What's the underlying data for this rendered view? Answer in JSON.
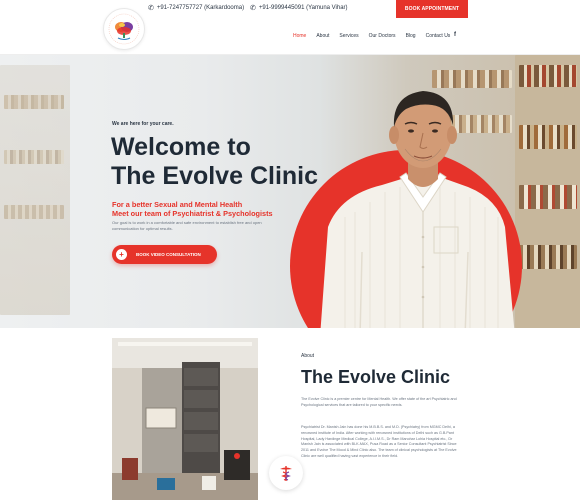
{
  "topbar": {
    "phone1": "+91-7247757727 (Karkardooma)",
    "phone2": "+91-9999445091 (Yamuna Vihar)",
    "book_label": "BOOK APPOINTMENT"
  },
  "nav": {
    "items": [
      "Home",
      "About",
      "Services",
      "Our Doctors",
      "Blog",
      "Contact Us"
    ],
    "active": "Home",
    "social": "f"
  },
  "hero": {
    "tagline": "We are here for your care.",
    "title_line1": "Welcome to",
    "title_line2": "The Evolve Clinic",
    "sub_line1": "For a better Sexual and Mental Health",
    "sub_line2": "Meet our team of Psychiatrist & Psychologists",
    "description": "Our goal is to work in a comfortable and safe environment to establish free and open communication for optimal results.",
    "cta_label": "BOOK VIDEO CONSULTATION",
    "cta_icon": "+"
  },
  "about": {
    "label": "About",
    "title": "The Evolve Clinic",
    "para1": "The Evolve Clinic is a premier centre for Mental Health. We offer state of the art Psychiatric and Psychological services that are tailored to your specific needs.",
    "para2": "Psychiatrist Dr. Manish Jain has done his M.B.B.S. and M.D. (Psychiatry) from MGMC Delhi, a renowned institute of India. After working with renowned institutions of Delhi such as G.B.Pant Hospital, Lady Hardinge Medical College, A.I.I.M.S., Dr Ram Manohar Lohia Hospital etc., Dr Manish Jain is associated with BLK-MAX, Pusa Road as a Senior Consultant Psychiatrist Since 2011 and Evolve The Mood & Mind Clinic also. The team of clinical psychologists at The Evolve Clinic are well qualified having vast experience in their field."
  },
  "colors": {
    "accent": "#e6332a",
    "dark_text": "#1f2a36"
  },
  "icons": [
    "phone-icon",
    "facebook-icon",
    "plus-icon",
    "logo-brain-icon",
    "caduceus-icon"
  ]
}
